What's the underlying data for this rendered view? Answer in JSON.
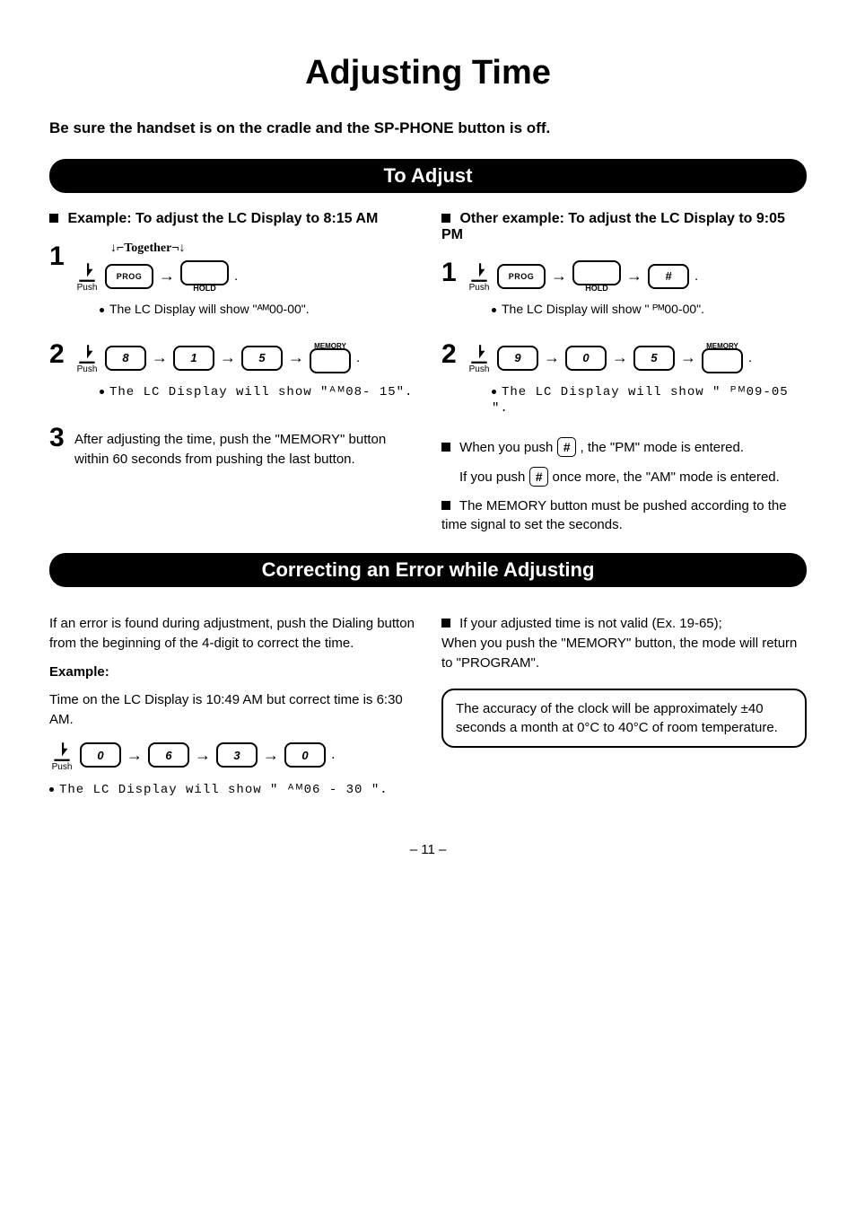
{
  "title": "Adjusting Time",
  "intro": "Be sure the handset is on the cradle and the SP-PHONE button is off.",
  "section1": "To Adjust",
  "section2": "Correcting an Error while Adjusting",
  "left": {
    "ex_head_prefix": "Example:",
    "ex_head": "To adjust the LC Display to 8:15 AM",
    "together": "Together",
    "push": "Push",
    "prog": "PROG",
    "hold": "HOLD",
    "memory": "MEMORY",
    "s1_result": "The LC Display will show \"ᴬᴹ00-00\".",
    "k8": "8",
    "k1": "1",
    "k5": "5",
    "s2_result": "The LC Display will show \"ᴬᴹ08- 15\".",
    "s3_text": "After adjusting the time, push the \"MEMORY\" button within 60 seconds from pushing the last button."
  },
  "right": {
    "ex_head_prefix": "Other example:",
    "ex_head": "To adjust the LC Display to 9:05 PM",
    "push": "Push",
    "prog": "PROG",
    "hold": "HOLD",
    "hash": "#",
    "memory": "MEMORY",
    "s1_result": "The LC Display will show \" ᴾᴹ00-00\".",
    "k9": "9",
    "k0": "0",
    "k5": "5",
    "s2_result": "The LC Display will show \" ᴾᴹ09-05 \".",
    "pm_note_a": "When you push ",
    "pm_note_b": ", the \"PM\" mode is entered.",
    "am_note_a": "If you push ",
    "am_note_b": " once more, the \"AM\" mode is entered.",
    "mem_note": "The MEMORY button must be pushed according to the time signal to set the seconds."
  },
  "correct": {
    "l1": "If an error is found during adjustment, push the Dialing button from the beginning of the 4-digit to correct the time.",
    "ex_label": "Example:",
    "l2": "Time on the LC Display is 10:49 AM but correct time is 6:30 AM.",
    "push": "Push",
    "k0a": "0",
    "k6": "6",
    "k3": "3",
    "k0b": "0",
    "result": "The LC Display will show \" ᴬᴹ06 - 30 \".",
    "r1": "If your adjusted time is not valid (Ex. 19-65);",
    "r2": "When you push the \"MEMORY\" button, the mode will return to \"PROGRAM\".",
    "box": "The accuracy of the clock will be approximately ±40 seconds a month at 0°C to 40°C of room temperature."
  },
  "page": "– 11 –"
}
